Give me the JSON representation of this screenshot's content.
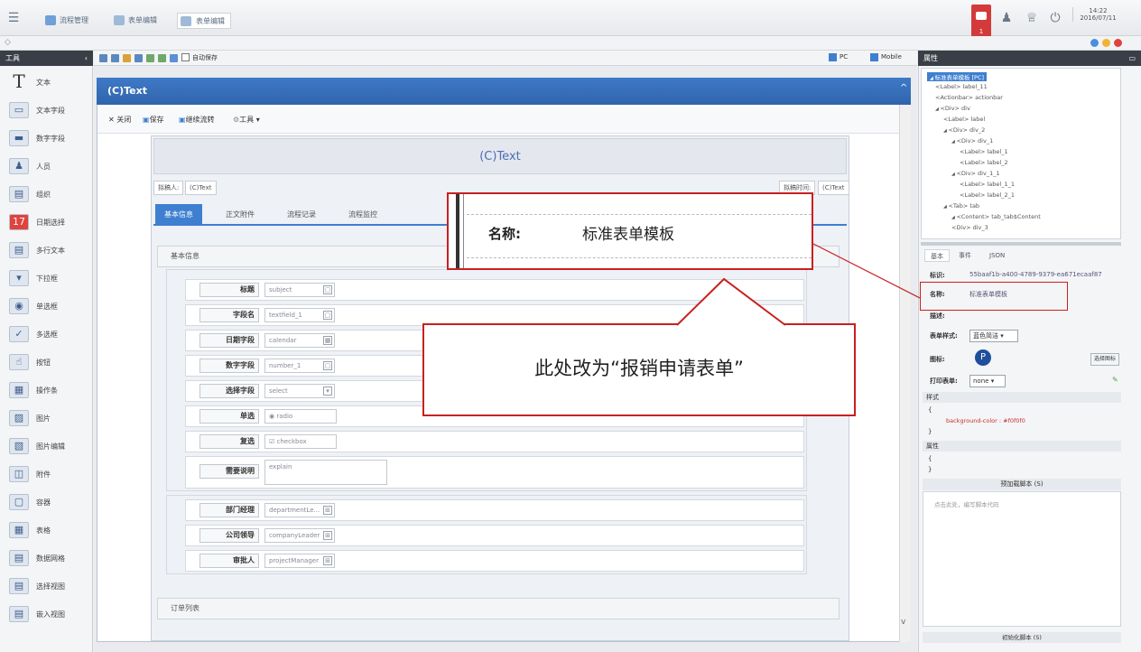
{
  "topbar": {
    "tabs": [
      "流程管理",
      "表单编辑",
      "表单编辑"
    ],
    "badge": "1",
    "time": "14:22",
    "date": "2016/07/11"
  },
  "toolbox": {
    "title": "工具",
    "items": [
      "文本",
      "文本字段",
      "数字字段",
      "人员",
      "组织",
      "日期选择",
      "多行文本",
      "下拉框",
      "单选框",
      "多选框",
      "按钮",
      "操作条",
      "图片",
      "图片编辑",
      "附件",
      "容器",
      "表格",
      "数据网格",
      "选择视图",
      "嵌入视图"
    ]
  },
  "editor_toolbar": {
    "autosave": "自动保存",
    "pc": "PC",
    "mobile": "Mobile"
  },
  "form": {
    "window_title": "(C)Text",
    "actions": [
      "关闭",
      "保存",
      "继续流转",
      "工具"
    ],
    "title": "(C)Text",
    "drafter_label": "拟稿人:",
    "drafter_value": "(C)Text",
    "time_label": "拟稿时间:",
    "time_value": "(C)Text",
    "tabs": [
      "基本信息",
      "正文附件",
      "流程记录",
      "流程监控"
    ],
    "section1": "基本信息",
    "rows": [
      {
        "label": "标题",
        "value": "subject",
        "icon": "▢"
      },
      {
        "label": "字段名",
        "value": "textfield_1",
        "icon": "▢"
      },
      {
        "label": "日期字段",
        "value": "calendar",
        "icon": "▦"
      },
      {
        "label": "数字字段",
        "value": "number_1",
        "icon": "▢"
      },
      {
        "label": "选择字段",
        "value": "select",
        "icon": "▾"
      },
      {
        "label": "单选",
        "value": "radio",
        "icon": ""
      },
      {
        "label": "复选",
        "value": "checkbox",
        "icon": ""
      },
      {
        "label": "需要说明",
        "value": "explain",
        "icon": ""
      }
    ],
    "rows2": [
      {
        "label": "部门经理",
        "value": "departmentLe...",
        "icon": "⊞"
      },
      {
        "label": "公司领导",
        "value": "companyLeader",
        "icon": "⊞"
      },
      {
        "label": "审批人",
        "value": "projectManager",
        "icon": "⊞"
      }
    ],
    "section2": "订单列表"
  },
  "properties": {
    "title": "属性",
    "tree": [
      "标准表单模板 [PC]",
      "<Label> label_11",
      "<Actionbar> actionbar",
      "<Div> div",
      "<Label> label",
      "<Div> div_2",
      "<Div> div_1",
      "<Label> label_1",
      "<Label> label_2",
      "<Div> div_1_1",
      "<Label> label_1_1",
      "<Label> label_2_1",
      "<Tab> tab",
      "<Content> tab_tab$Content",
      "<Div> div_3"
    ],
    "tabs": [
      "基本",
      "事件",
      "JSON"
    ],
    "id_label": "标识:",
    "id_value": "55baaf1b-a400-4789-9379-ea671ecaaf87",
    "name_label": "名称:",
    "name_value": "标准表单模板",
    "desc_label": "描述:",
    "style_label": "表单样式:",
    "style_value": "蓝色简洁",
    "icon_label": "图标:",
    "icon_btn": "选择图标",
    "print_label": "打印表单:",
    "print_value": "none",
    "css_title": "样式",
    "css_line": "background-color : #f0f0f0",
    "attr_title": "属性",
    "script_title": "预加载脚本 (S)",
    "script_placeholder": "点击此处，编写脚本代码",
    "bottom_title": "初始化脚本 (S)"
  },
  "zoom": {
    "label": "名称:",
    "value": "标准表单模板"
  },
  "callout": {
    "text": "此处改为“报销申请表单”"
  },
  "colors": {
    "accent": "#2f65ad",
    "annotation": "#c82020"
  }
}
